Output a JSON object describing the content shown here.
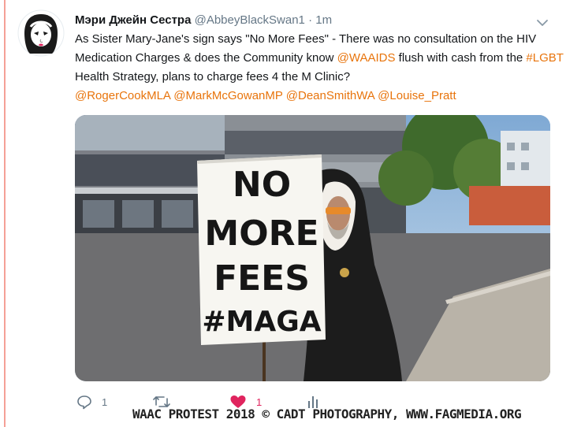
{
  "tweet": {
    "display_name": "Мэри Джейн Сестра",
    "handle": "@AbbeyBlackSwan1",
    "separator": "·",
    "time": "1m",
    "text": {
      "p1": "As Sister Mary-Jane's sign says \"No More Fees\" - There was no consultation on the HIV Medication Charges & does the Community know ",
      "mention_waaids": "@WAAIDS",
      "p2": " flush with cash from the ",
      "hashtag_lgbt": "#LGBT",
      "p3": " Health Strategy, plans to charge fees 4 the M Clinic?",
      "mention_rogercook": "@RogerCookMLA",
      "mention_markmcgowan": "@MarkMcGowanMP",
      "mention_deansmith": "@DeanSmithWA",
      "mention_louisepratt": "@Louise_Pratt"
    },
    "photo": {
      "sign_lines": [
        "NO",
        "MORE",
        "FEES",
        "#MAGA"
      ]
    },
    "actions": {
      "reply_count": "1",
      "retweet_count": "",
      "like_count": "1"
    },
    "watermark": "WAAC PROTEST 2018 © CADT PHOTOGRAPHY, WWW.FAGMEDIA.ORG"
  },
  "colors": {
    "link": "#e8740c",
    "like": "#e0245e",
    "thread_line": "#f5a097"
  },
  "icons": [
    "nun-avatar-icon",
    "chevron-down-icon",
    "reply-icon",
    "retweet-icon",
    "heart-icon",
    "analytics-icon"
  ]
}
